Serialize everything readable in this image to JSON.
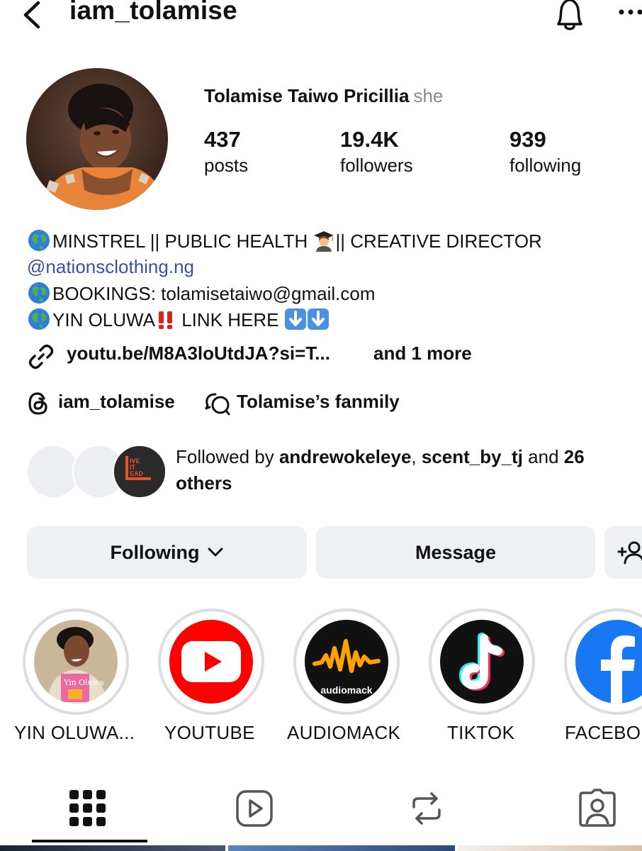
{
  "header": {
    "username": "iam_tolamise"
  },
  "profile": {
    "full_name": "Tolamise Taiwo Pricillia",
    "pronoun": "she",
    "stats": [
      {
        "value": "437",
        "label": "posts"
      },
      {
        "value": "19.4K",
        "label": "followers"
      },
      {
        "value": "939",
        "label": "following"
      }
    ]
  },
  "bio": {
    "line1_a": "MINSTREL || PUBLIC HEALTH ",
    "line1_b": "|| CREATIVE DIRECTOR",
    "line2": "@nationsclothing.ng",
    "line3": "BOOKINGS: tolamisetaiwo@gmail.com",
    "line4_a": "YIN OLUWA",
    "line4_b": "LINK HERE ",
    "link": "youtu.be/M8A3loUtdJA?si=T...",
    "link_more": "and 1 more"
  },
  "threads": {
    "handle": "iam_tolamise",
    "channel": "Tolamise’s fanmily"
  },
  "followed_by": {
    "prefix": "Followed by ",
    "user1": "andrewokeleye",
    "sep": ", ",
    "user2": "scent_by_tj",
    "and": " and ",
    "count": "26 others",
    "badge_text": "LIVE IT LEAD"
  },
  "buttons": {
    "following": "Following",
    "message": "Message"
  },
  "highlights": [
    {
      "label": "YIN OLUWA..."
    },
    {
      "label": "YOUTUBE"
    },
    {
      "label": "AUDIOMACK"
    },
    {
      "label": "TIKTOK"
    },
    {
      "label": "FACEBO"
    }
  ],
  "highlight_badges": {
    "audiomack": "audiomack"
  },
  "colors": {
    "link_blue": "#3a4fa8",
    "button_bg": "#eff0f3",
    "youtube_red": "#ff0000",
    "audiomack_orange": "#ffa200",
    "facebook_blue": "#1877f2"
  },
  "icons": {
    "back": "chevron-left",
    "bell": "bell",
    "more": "ellipsis-horizontal",
    "link": "chain-link",
    "threads": "threads-logo",
    "community": "chat-bubbles",
    "add_user": "person-plus",
    "tabs": [
      "grid",
      "reels-play",
      "reposts",
      "tagged"
    ]
  }
}
